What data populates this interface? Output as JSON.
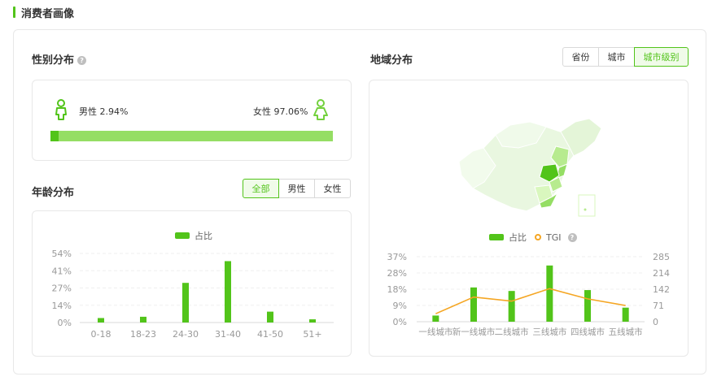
{
  "section": {
    "title": "消费者画像"
  },
  "gender": {
    "title": "性别分布",
    "male_label": "男性 2.94%",
    "female_label": "女性 97.06%",
    "male_share": 2.94,
    "colors": {
      "male": "#52c41a",
      "female": "#95de64"
    }
  },
  "age": {
    "title": "年龄分布",
    "filters": [
      "全部",
      "男性",
      "女性"
    ],
    "active_filter": "全部"
  },
  "region": {
    "title": "地域分布",
    "filters": [
      "省份",
      "城市",
      "城市级别"
    ],
    "active_filter": "城市级别"
  },
  "chart_data": [
    {
      "type": "bar",
      "legend": [
        "占比"
      ],
      "categories": [
        "0-18",
        "18-23",
        "24-30",
        "31-40",
        "41-50",
        "51+"
      ],
      "series": [
        {
          "name": "占比",
          "values": [
            3.5,
            4.5,
            31,
            48,
            8.5,
            2.5
          ]
        }
      ],
      "yticks": [
        "0%",
        "14%",
        "27%",
        "41%",
        "54%"
      ],
      "ylim": [
        0,
        54
      ],
      "grid": true,
      "legend_position": "top-center",
      "color": "#52c41a"
    },
    {
      "type": "bar",
      "legend": [
        "占比",
        "TGI"
      ],
      "categories": [
        "一线城市",
        "新一线城市",
        "二线城市",
        "三线城市",
        "四线城市",
        "五线城市"
      ],
      "series": [
        {
          "name": "占比",
          "type": "bar",
          "axis": "left",
          "values": [
            3.5,
            19.5,
            17.5,
            32,
            18,
            8
          ]
        },
        {
          "name": "TGI",
          "type": "line",
          "axis": "right",
          "values": [
            35,
            108,
            90,
            145,
            100,
            71
          ]
        }
      ],
      "yticks_left": [
        "0%",
        "9%",
        "18%",
        "28%",
        "37%"
      ],
      "yticks_right": [
        "0",
        "71",
        "142",
        "214",
        "285"
      ],
      "ylim_left": [
        0,
        37
      ],
      "ylim_right": [
        0,
        285
      ],
      "grid": true,
      "legend_position": "top-center",
      "colors": {
        "bar": "#52c41a",
        "line": "#f5a623"
      }
    }
  ]
}
